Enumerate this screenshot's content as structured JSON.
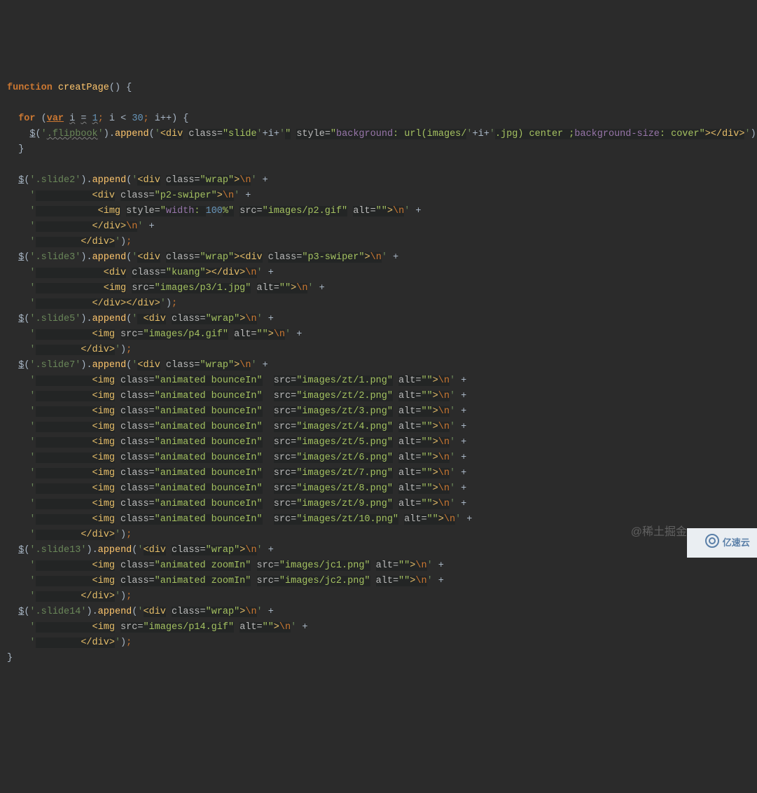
{
  "domain": "Computer-Use",
  "language": "javascript",
  "function_name": "creatPage",
  "loop": {
    "init": "var i = 1",
    "i_start": "1",
    "condition": "i < 30",
    "limit": "30",
    "step": "i++"
  },
  "line1_parts": {
    "selector": ".flipbook",
    "method": "append",
    "open": "<div",
    "class_attr": "class=",
    "class_val": "slide",
    "i_var": "+i+",
    "style_attr": "style=",
    "css_bg": "background",
    "css_url": "url",
    "url_path": "images/",
    "url_ext": ".jpg",
    "css_center": "center",
    "css_sep": ";",
    "css_bgsize": "background-size",
    "css_cover": "cover",
    "close": "></div>"
  },
  "slide2": {
    "selector": ".slide2",
    "lines": [
      "<div class=\"wrap\">\\n",
      "          <div class=\"p2-swiper\">\\n",
      "           <img style=\"width: 100%\" src=\"images/p2.gif\" alt=\"\">\\n",
      "          </div>\\n",
      "        </div>"
    ]
  },
  "slide3": {
    "selector": ".slide3",
    "lines": [
      "<div class=\"wrap\"><div class=\"p3-swiper\">\\n",
      "            <div class=\"kuang\"></div>\\n",
      "            <img src=\"images/p3/1.jpg\" alt=\"\">\\n",
      "          </div></div>"
    ]
  },
  "slide5": {
    "selector": ".slide5",
    "lines": [
      " <div class=\"wrap\">\\n",
      "          <img src=\"images/p4.gif\" alt=\"\">\\n",
      "        </div>"
    ]
  },
  "slide7": {
    "selector": ".slide7",
    "lines": [
      "<div class=\"wrap\">\\n",
      "          <img class=\"animated bounceIn\"  src=\"images/zt/1.png\" alt=\"\">\\n",
      "          <img class=\"animated bounceIn\"  src=\"images/zt/2.png\" alt=\"\">\\n",
      "          <img class=\"animated bounceIn\"  src=\"images/zt/3.png\" alt=\"\">\\n",
      "          <img class=\"animated bounceIn\"  src=\"images/zt/4.png\" alt=\"\">\\n",
      "          <img class=\"animated bounceIn\"  src=\"images/zt/5.png\" alt=\"\">\\n",
      "          <img class=\"animated bounceIn\"  src=\"images/zt/6.png\" alt=\"\">\\n",
      "          <img class=\"animated bounceIn\"  src=\"images/zt/7.png\" alt=\"\">\\n",
      "          <img class=\"animated bounceIn\"  src=\"images/zt/8.png\" alt=\"\">\\n",
      "          <img class=\"animated bounceIn\"  src=\"images/zt/9.png\" alt=\"\">\\n",
      "          <img class=\"animated bounceIn\"  src=\"images/zt/10.png\" alt=\"\">\\n",
      "        </div>"
    ]
  },
  "slide13": {
    "selector": ".slide13",
    "lines": [
      "<div class=\"wrap\">\\n",
      "          <img class=\"animated zoomIn\" src=\"images/jc1.png\" alt=\"\">\\n",
      "          <img class=\"animated zoomIn\" src=\"images/jc2.png\" alt=\"\">\\n",
      "        </div>"
    ]
  },
  "slide14": {
    "selector": ".slide14",
    "lines": [
      "<div class=\"wrap\">\\n",
      "          <img src=\"images/p14.gif\" alt=\"\">\\n",
      "        </div>"
    ]
  },
  "watermark1": "@稀土掘金",
  "watermark2": "亿速云"
}
